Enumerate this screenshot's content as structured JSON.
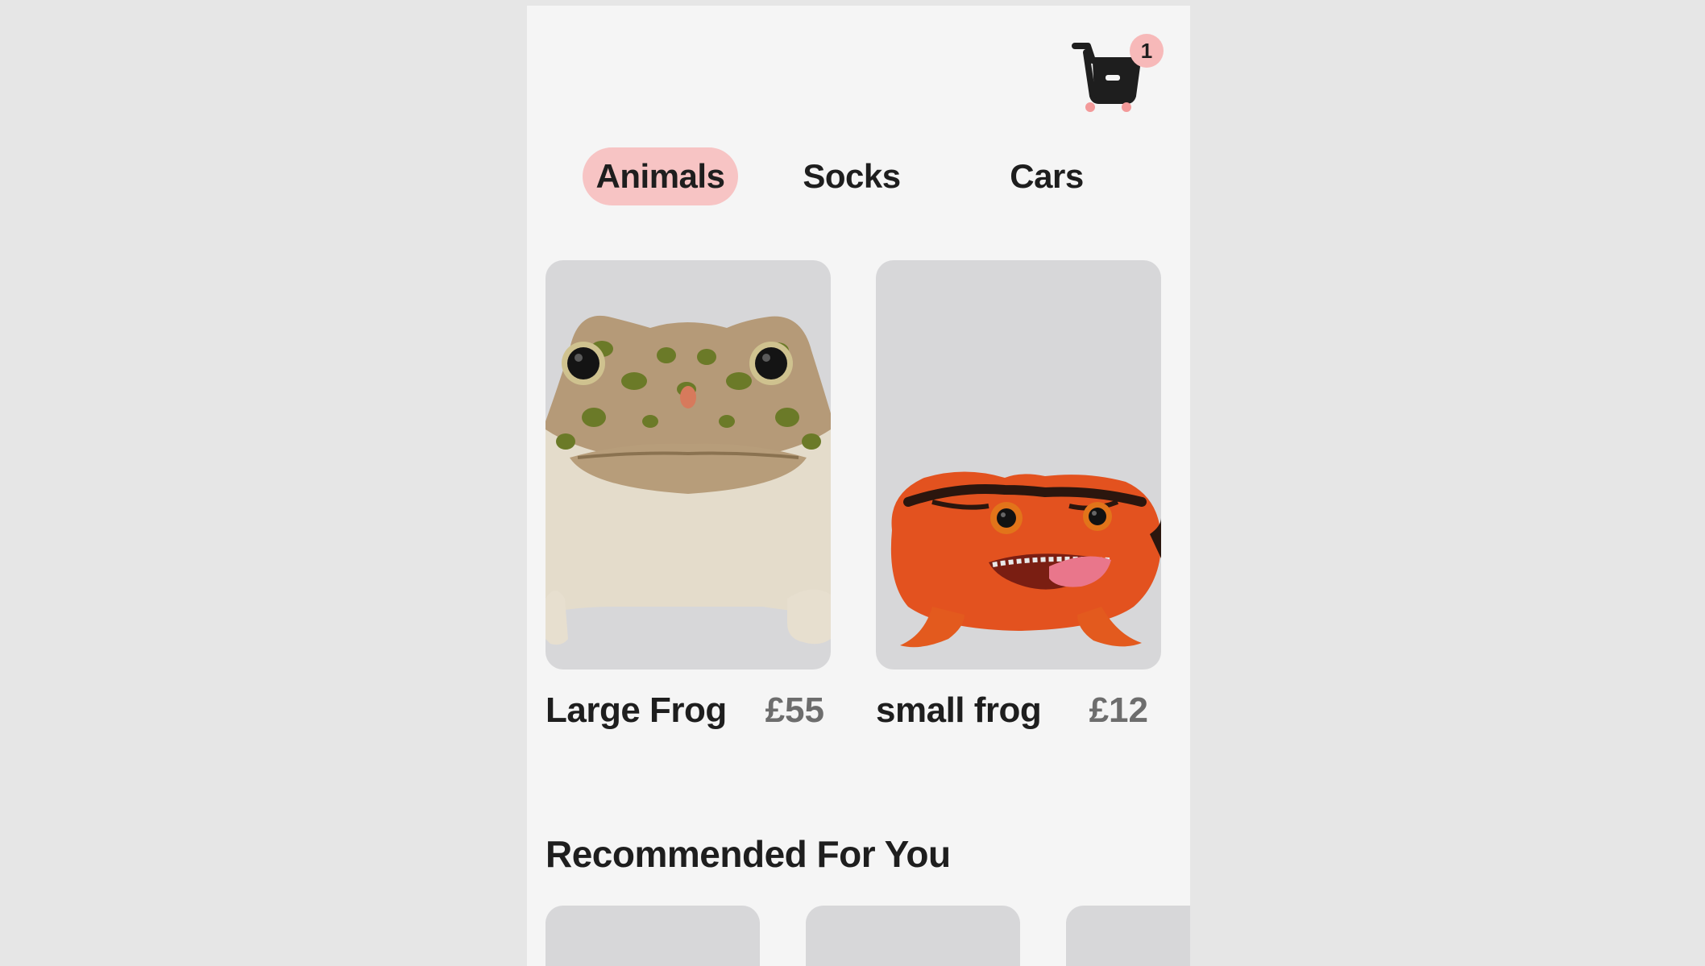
{
  "cart": {
    "icon": "shopping-cart-icon",
    "count": "1",
    "accent_color": "#f7b9b9"
  },
  "tabs": [
    {
      "label": "Animals",
      "active": true
    },
    {
      "label": "Socks",
      "active": false
    },
    {
      "label": "Cars",
      "active": false
    }
  ],
  "products": [
    {
      "name": "Large Frog",
      "price": "£55",
      "image": "green-spotted-toad"
    },
    {
      "name": "small frog",
      "price": "£12",
      "image": "orange-tomato-frog"
    }
  ],
  "recommended": {
    "title": "Recommended For You"
  },
  "colors": {
    "active_tab": "#f7c4c4",
    "card_background": "#d7d7d9",
    "page_background": "#f5f5f5"
  }
}
